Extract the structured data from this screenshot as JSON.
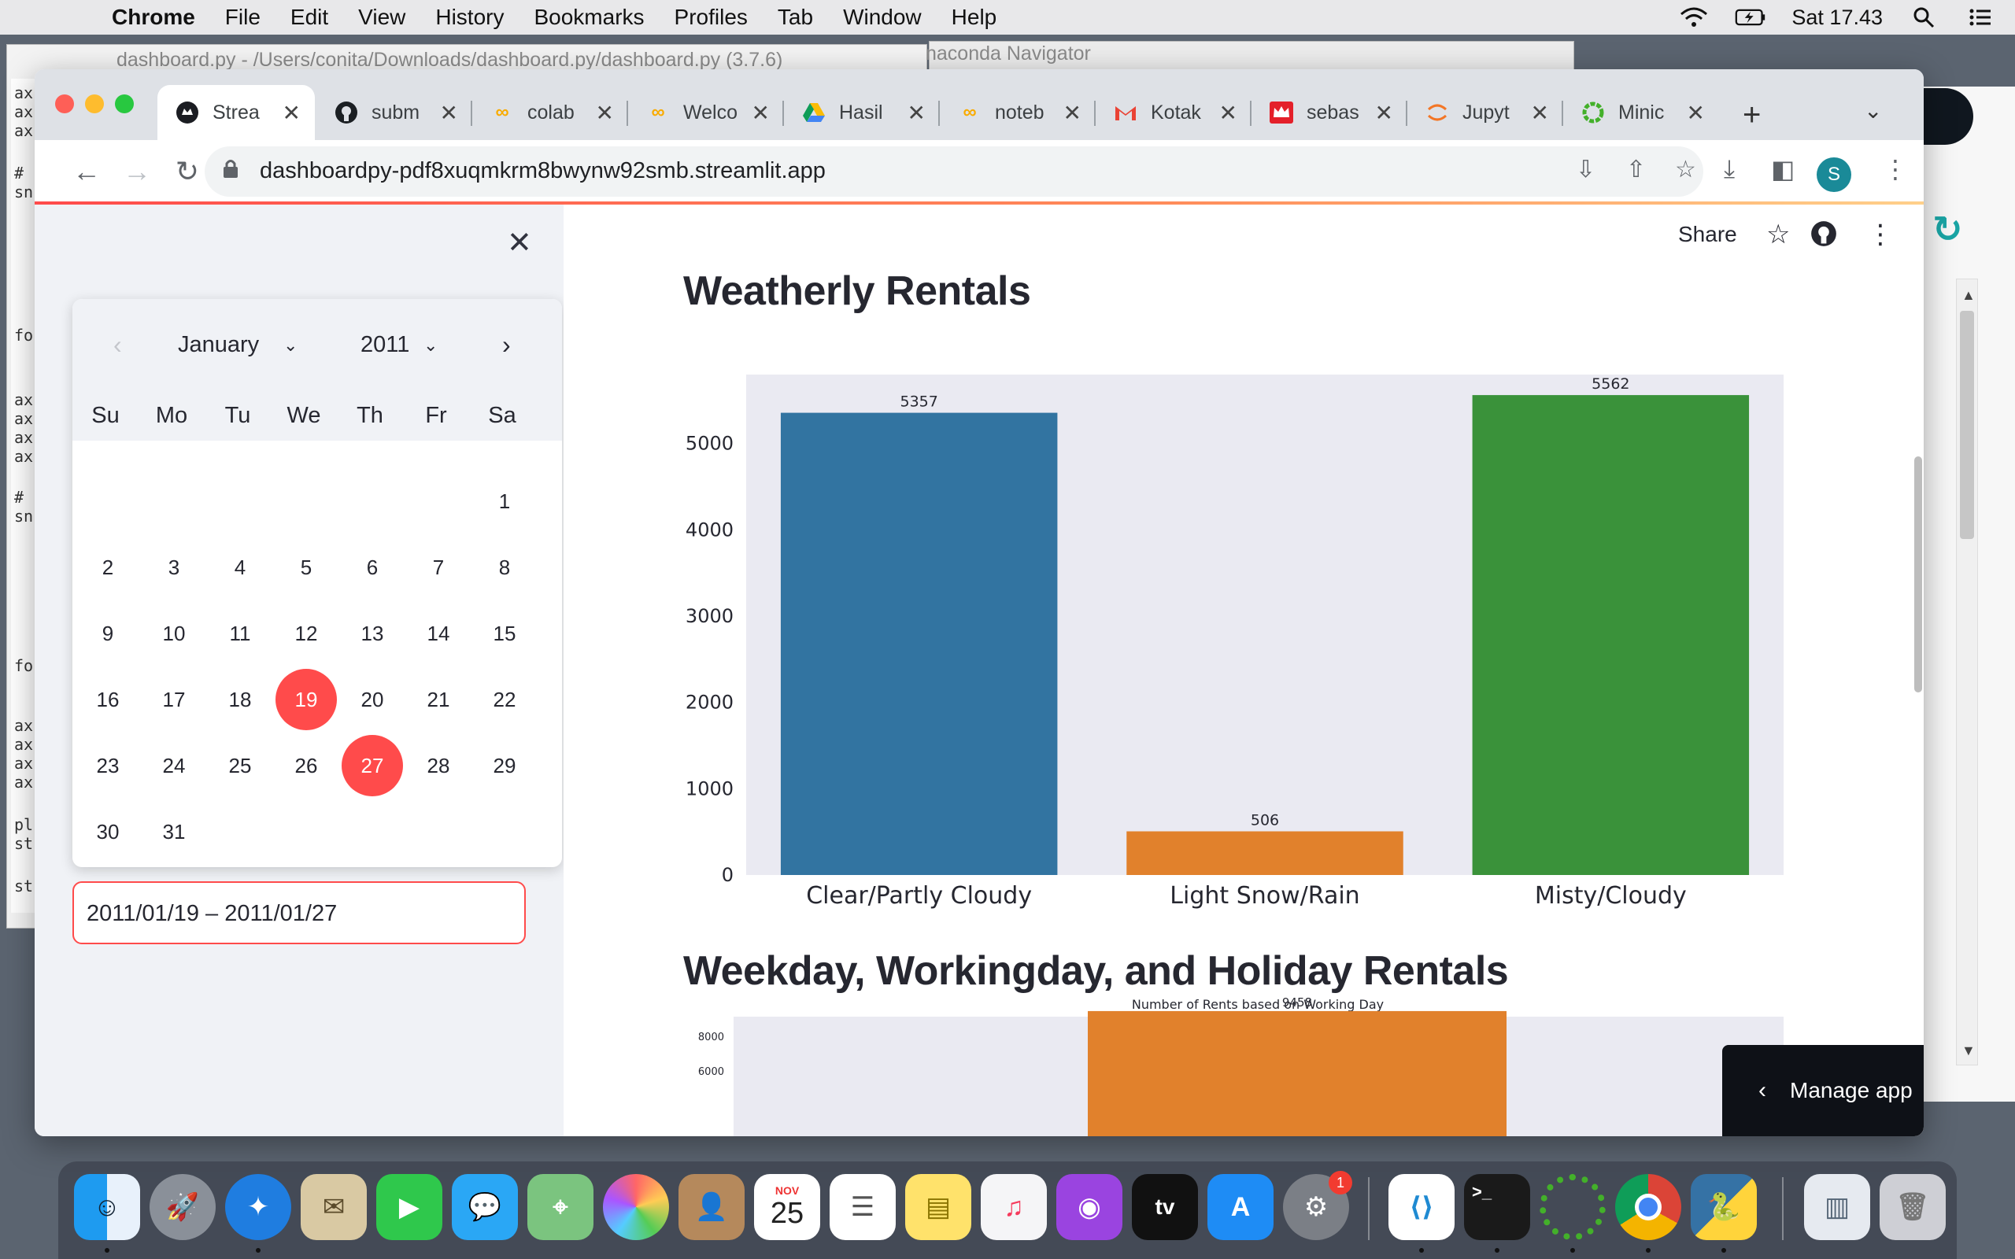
{
  "menubar": {
    "app": "Chrome",
    "items": [
      "File",
      "Edit",
      "View",
      "History",
      "Bookmarks",
      "Profiles",
      "Tab",
      "Window",
      "Help"
    ],
    "clock": "Sat 17.43"
  },
  "background_windows": {
    "editor_title": "dashboard.py - /Users/conita/Downloads/dashboard.py/dashboard.py (3.7.6)",
    "navigator_title": "naconda Navigator"
  },
  "tabs": [
    {
      "label": "Strea",
      "icon": "streamlit-icon",
      "active": true
    },
    {
      "label": "subm",
      "icon": "github-icon"
    },
    {
      "label": "colab",
      "icon": "colab-icon"
    },
    {
      "label": "Welco",
      "icon": "colab-icon"
    },
    {
      "label": "Hasil",
      "icon": "google-drive-icon"
    },
    {
      "label": "noteb",
      "icon": "colab-icon"
    },
    {
      "label": "Kotak",
      "icon": "gmail-icon"
    },
    {
      "label": "sebas",
      "icon": "crown-icon"
    },
    {
      "label": "Jupyt",
      "icon": "jupyter-icon"
    },
    {
      "label": "Minic",
      "icon": "miniconda-icon"
    }
  ],
  "address_bar": {
    "url": "dashboardpy-pdf8xuqmkrm8bwynw92smb.streamlit.app"
  },
  "profile_initial": "S",
  "streamlit_header": {
    "share_label": "Share"
  },
  "datepicker": {
    "month": "January",
    "year": "2011",
    "weekdays": [
      "Su",
      "Mo",
      "Tu",
      "We",
      "Th",
      "Fr",
      "Sa"
    ],
    "selected_days": [
      19,
      27
    ],
    "input_value": "2011/01/19 – 2011/01/27"
  },
  "sections": {
    "weatherly_title": "Weatherly Rentals",
    "weekday_title": "Weekday, Workingday, and Holiday Rentals"
  },
  "chart_data": [
    {
      "type": "bar",
      "categories": [
        "Clear/Partly Cloudy",
        "Light Snow/Rain",
        "Misty/Cloudy"
      ],
      "values": [
        5357,
        506,
        5562
      ],
      "data_labels": [
        "5357",
        "506",
        "5562"
      ],
      "title": "",
      "ylim": [
        0,
        5800
      ],
      "yticks": [
        0,
        1000,
        2000,
        3000,
        4000,
        5000
      ],
      "colors": [
        "#3274a1",
        "#e1812c",
        "#3a923a"
      ],
      "background": "#eaeaf2"
    },
    {
      "type": "bar",
      "title": "Number of Rents based on Working Day",
      "visible_values": [
        9458
      ],
      "data_labels": [
        "9458"
      ],
      "yticks_visible": [
        8000,
        6000
      ],
      "colors": [
        "#e1812c"
      ],
      "background": "#eaeaf2"
    }
  ],
  "manage_app": {
    "label": "Manage app"
  },
  "dock": {
    "calendar_month": "NOV",
    "calendar_day": "25",
    "settings_badge": "1"
  }
}
